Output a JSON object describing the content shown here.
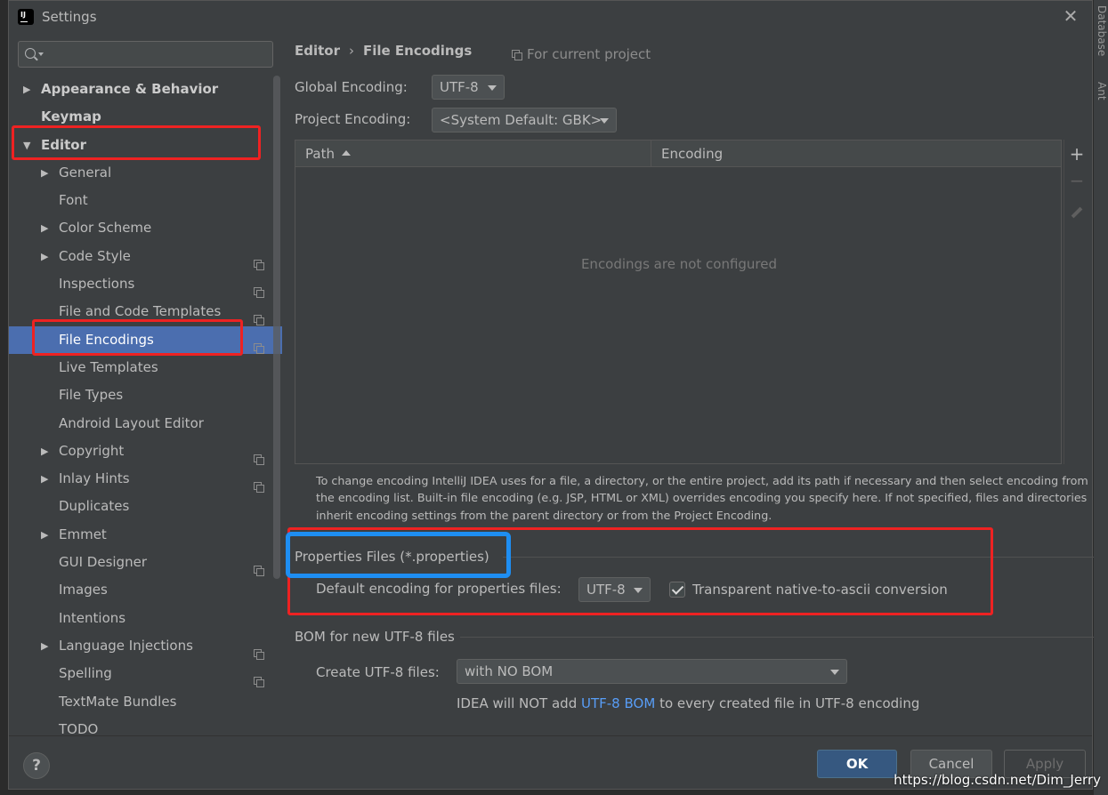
{
  "window": {
    "title": "Settings",
    "close_glyph": "✕",
    "app_icon": "intellij-idea-icon"
  },
  "edge": {
    "right_top": "Database",
    "right_mid": "Ant"
  },
  "search": {
    "placeholder": "",
    "value": ""
  },
  "tree": [
    {
      "label": "Appearance & Behavior",
      "bold": true,
      "expandable": true,
      "expanded": false,
      "level": 0,
      "project": false,
      "selected": false
    },
    {
      "label": "Keymap",
      "bold": true,
      "expandable": false,
      "expanded": false,
      "level": 0,
      "project": false,
      "selected": false
    },
    {
      "label": "Editor",
      "bold": true,
      "expandable": true,
      "expanded": true,
      "level": 0,
      "project": false,
      "selected": false
    },
    {
      "label": "General",
      "bold": false,
      "expandable": true,
      "expanded": false,
      "level": 1,
      "project": false,
      "selected": false
    },
    {
      "label": "Font",
      "bold": false,
      "expandable": false,
      "expanded": false,
      "level": 1,
      "project": false,
      "selected": false
    },
    {
      "label": "Color Scheme",
      "bold": false,
      "expandable": true,
      "expanded": false,
      "level": 1,
      "project": false,
      "selected": false
    },
    {
      "label": "Code Style",
      "bold": false,
      "expandable": true,
      "expanded": false,
      "level": 1,
      "project": true,
      "selected": false
    },
    {
      "label": "Inspections",
      "bold": false,
      "expandable": false,
      "expanded": false,
      "level": 1,
      "project": true,
      "selected": false
    },
    {
      "label": "File and Code Templates",
      "bold": false,
      "expandable": false,
      "expanded": false,
      "level": 1,
      "project": true,
      "selected": false
    },
    {
      "label": "File Encodings",
      "bold": false,
      "expandable": false,
      "expanded": false,
      "level": 1,
      "project": true,
      "selected": true
    },
    {
      "label": "Live Templates",
      "bold": false,
      "expandable": false,
      "expanded": false,
      "level": 1,
      "project": false,
      "selected": false
    },
    {
      "label": "File Types",
      "bold": false,
      "expandable": false,
      "expanded": false,
      "level": 1,
      "project": false,
      "selected": false
    },
    {
      "label": "Android Layout Editor",
      "bold": false,
      "expandable": false,
      "expanded": false,
      "level": 1,
      "project": false,
      "selected": false
    },
    {
      "label": "Copyright",
      "bold": false,
      "expandable": true,
      "expanded": false,
      "level": 1,
      "project": true,
      "selected": false
    },
    {
      "label": "Inlay Hints",
      "bold": false,
      "expandable": true,
      "expanded": false,
      "level": 1,
      "project": true,
      "selected": false
    },
    {
      "label": "Duplicates",
      "bold": false,
      "expandable": false,
      "expanded": false,
      "level": 1,
      "project": false,
      "selected": false
    },
    {
      "label": "Emmet",
      "bold": false,
      "expandable": true,
      "expanded": false,
      "level": 1,
      "project": false,
      "selected": false
    },
    {
      "label": "GUI Designer",
      "bold": false,
      "expandable": false,
      "expanded": false,
      "level": 1,
      "project": true,
      "selected": false
    },
    {
      "label": "Images",
      "bold": false,
      "expandable": false,
      "expanded": false,
      "level": 1,
      "project": false,
      "selected": false
    },
    {
      "label": "Intentions",
      "bold": false,
      "expandable": false,
      "expanded": false,
      "level": 1,
      "project": false,
      "selected": false
    },
    {
      "label": "Language Injections",
      "bold": false,
      "expandable": true,
      "expanded": false,
      "level": 1,
      "project": true,
      "selected": false
    },
    {
      "label": "Spelling",
      "bold": false,
      "expandable": false,
      "expanded": false,
      "level": 1,
      "project": true,
      "selected": false
    },
    {
      "label": "TextMate Bundles",
      "bold": false,
      "expandable": false,
      "expanded": false,
      "level": 1,
      "project": false,
      "selected": false
    },
    {
      "label": "TODO",
      "bold": false,
      "expandable": false,
      "expanded": false,
      "level": 1,
      "project": false,
      "selected": false
    }
  ],
  "breadcrumb": {
    "parent": "Editor",
    "separator": "›",
    "current": "File Encodings"
  },
  "scope_note": "For current project",
  "global_encoding": {
    "label": "Global Encoding:",
    "value": "UTF-8"
  },
  "project_encoding": {
    "label": "Project Encoding:",
    "value": "<System Default: GBK>"
  },
  "table": {
    "columns": [
      "Path",
      "Encoding"
    ],
    "sorted_column": "Path",
    "sort_direction": "ascending",
    "empty_text": "Encodings are not configured",
    "toolbar": {
      "add": "+",
      "remove": "−"
    }
  },
  "help_text": "To change encoding IntelliJ IDEA uses for a file, a directory, or the entire project, add its path if necessary and then select encoding from the encoding list. Built-in file encoding (e.g. JSP, HTML or XML) overrides encoding you specify here. If not specified, files and directories inherit encoding settings from the parent directory or from the Project Encoding.",
  "properties": {
    "title": "Properties Files (*.properties)",
    "default_label": "Default encoding for properties files:",
    "default_value": "UTF-8",
    "native_ascii_label": "Transparent native-to-ascii conversion",
    "native_ascii_checked": true
  },
  "bom": {
    "title": "BOM for new UTF-8 files",
    "create_label": "Create UTF-8 files:",
    "create_value": "with NO BOM",
    "note_prefix": "IDEA will NOT add",
    "note_link": "UTF-8 BOM",
    "note_suffix": "to every created file in UTF-8 encoding"
  },
  "buttons": {
    "help": "?",
    "ok": "OK",
    "cancel": "Cancel",
    "apply": "Apply"
  },
  "watermark": "https://blog.csdn.net/Dim_Jerry",
  "colors": {
    "accent_selection": "#4b6eaf",
    "annotation_red": "#e22222",
    "annotation_blue": "#1e8ef2",
    "link": "#589df6",
    "ok_button": "#365880"
  }
}
